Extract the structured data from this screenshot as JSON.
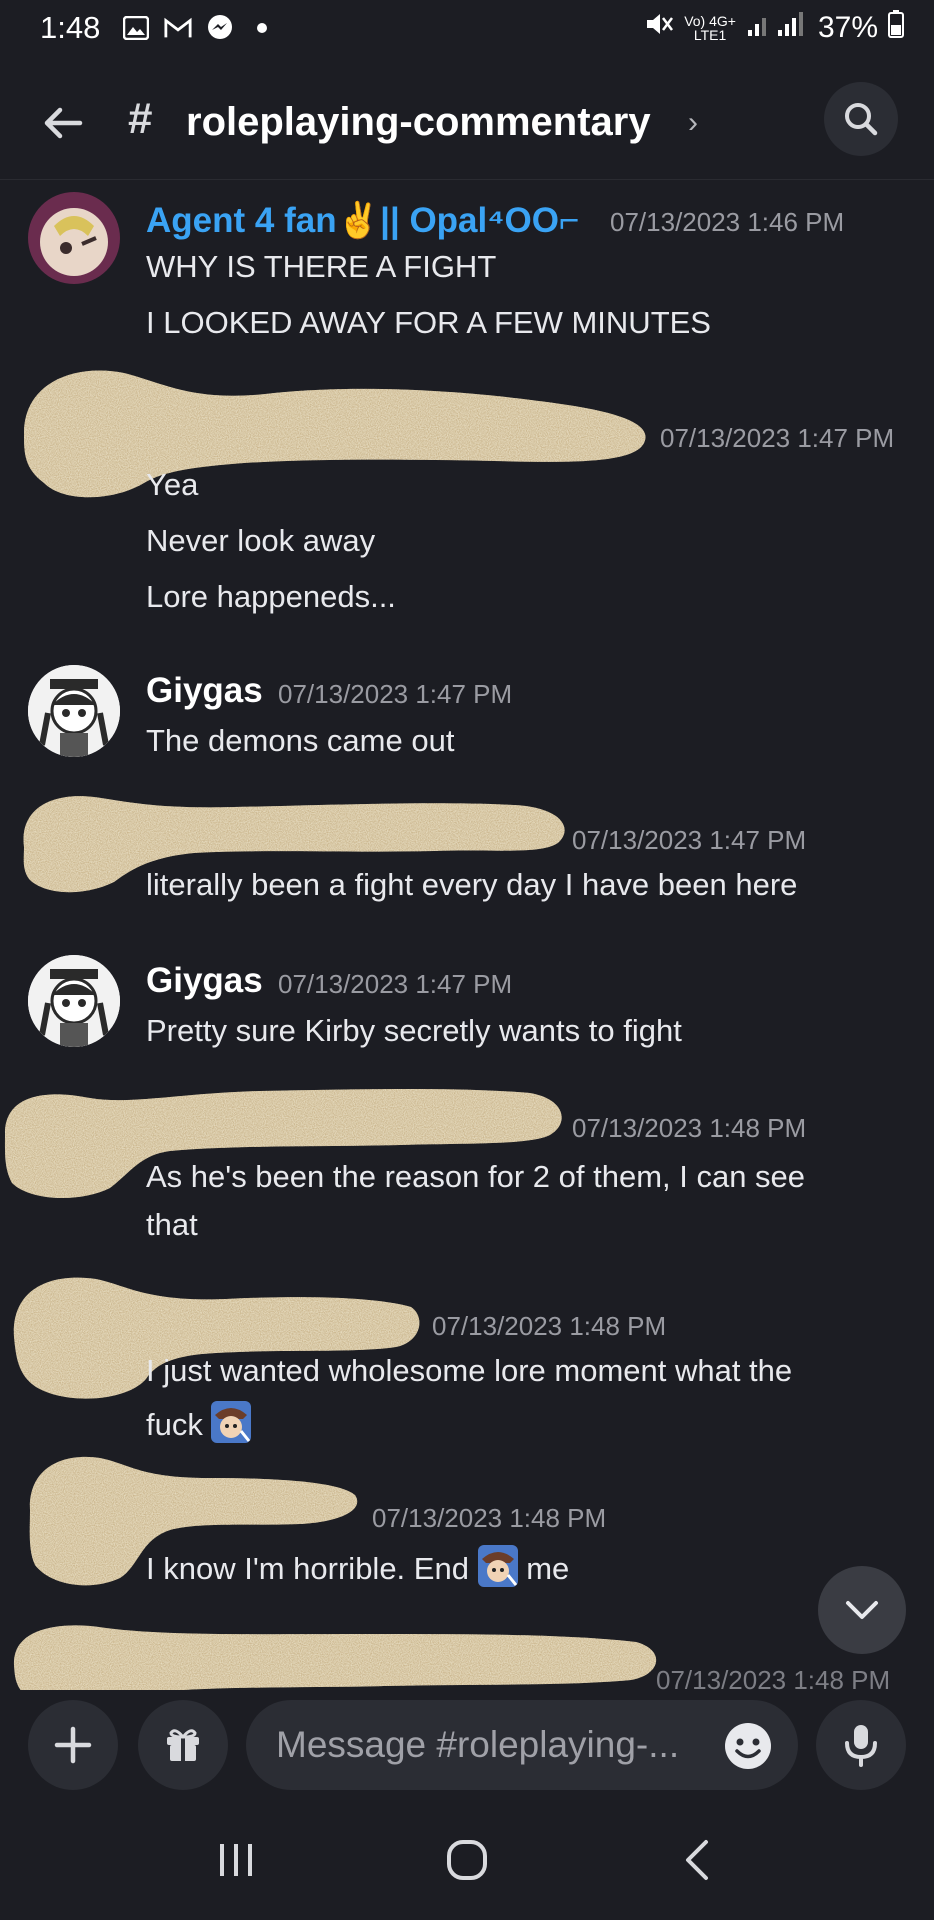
{
  "status_bar": {
    "time": "1:48",
    "left_icons": [
      "gallery-icon",
      "gmail-icon",
      "messenger-icon",
      "dot-icon"
    ],
    "network_top": "Vo) 4G+",
    "network_bottom": "LTE1",
    "battery": "37%"
  },
  "header": {
    "channel_name": "roleplaying-commentary",
    "hash": "#",
    "chevron": "›"
  },
  "messages": [
    {
      "author": "Agent 4 fan✌️|| Opal⁴OO⌐",
      "author_color": "#3aa3f4",
      "timestamp": "07/13/2023 1:46 PM",
      "lines": [
        "WHY IS THERE A FIGHT",
        "I LOOKED AWAY FOR A FEW MINUTES"
      ]
    },
    {
      "author": "",
      "timestamp": "07/13/2023 1:47 PM",
      "lines": [
        "Yea",
        "Never look away",
        "Lore happeneds..."
      ]
    },
    {
      "author": "Giygas",
      "author_color": "#ffffff",
      "timestamp": "07/13/2023 1:47 PM",
      "lines": [
        "The demons came out"
      ]
    },
    {
      "author": "",
      "timestamp": "07/13/2023 1:47 PM",
      "lines": [
        "literally been a fight every day I have been here"
      ]
    },
    {
      "author": "Giygas",
      "author_color": "#ffffff",
      "timestamp": "07/13/2023 1:47 PM",
      "lines": [
        "Pretty sure Kirby secretly wants to fight"
      ]
    },
    {
      "author": "",
      "timestamp": "07/13/2023 1:48 PM",
      "lines": [
        "As he's been the reason for 2 of them, I can see",
        "that"
      ]
    },
    {
      "author": "",
      "timestamp": "07/13/2023 1:48 PM",
      "lines": [
        "I just wanted wholesome lore moment what the",
        "fuck"
      ]
    },
    {
      "author": "",
      "timestamp": "07/13/2023 1:48 PM",
      "lines": [
        "I know I'm horrible. End",
        "me"
      ]
    },
    {
      "author": "",
      "timestamp": "07/13/2023 1:48 PM",
      "lines": []
    }
  ],
  "composer": {
    "placeholder": "Message #roleplaying-..."
  },
  "colors": {
    "background": "#1c1d23",
    "accent_blue": "#3aa3f4",
    "timestamp": "#9a9ba2",
    "redaction": "#c9b48a"
  }
}
